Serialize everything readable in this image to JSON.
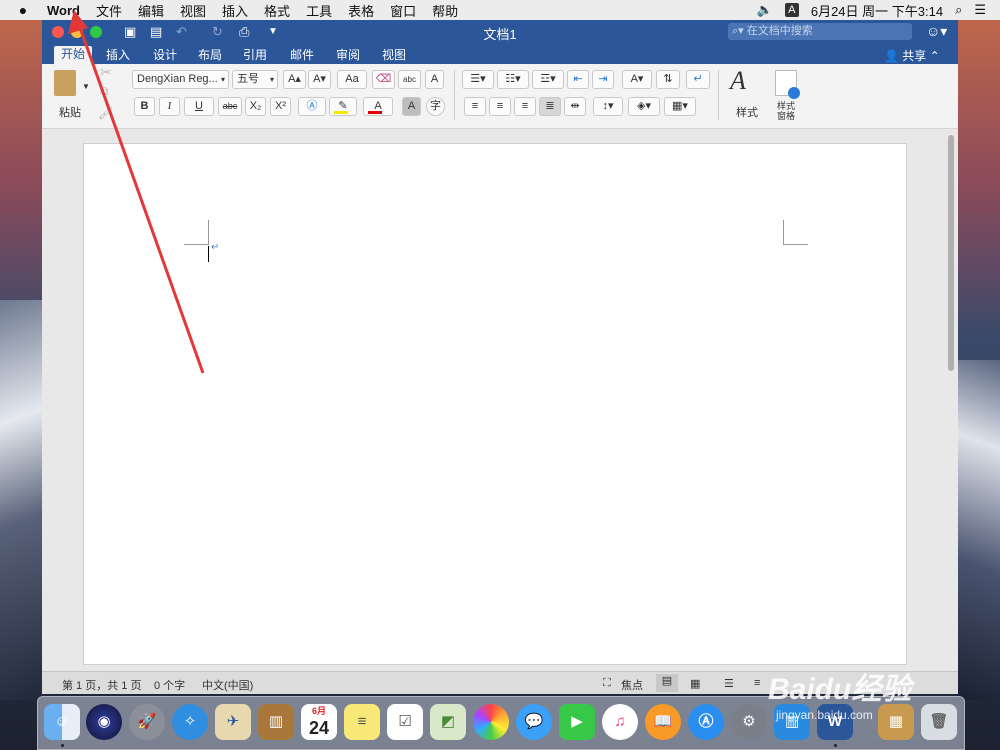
{
  "menubar": {
    "app_name": "Word",
    "menus": [
      "文件",
      "编辑",
      "视图",
      "插入",
      "格式",
      "工具",
      "表格",
      "窗口",
      "帮助"
    ],
    "input_method": "A",
    "clock": "6月24日 周一 下午3:14"
  },
  "window": {
    "title": "文档1",
    "search_placeholder": "在文档中搜索",
    "share_label": "共享",
    "tabs": [
      "开始",
      "插入",
      "设计",
      "布局",
      "引用",
      "邮件",
      "审阅",
      "视图"
    ],
    "active_tab": "开始"
  },
  "ribbon": {
    "paste_label": "粘贴",
    "font_name": "DengXian Reg...",
    "font_size": "五号",
    "bold": "B",
    "italic": "I",
    "underline": "U",
    "strikethrough": "abc",
    "subscript": "X₂",
    "superscript": "X²",
    "styles_label": "样式",
    "styles_pane_label": "样式\n窗格",
    "styles_pane_line1": "样式",
    "styles_pane_line2": "窗格",
    "grow_font": "A▴",
    "shrink_font": "A▾",
    "change_case": "Aa",
    "phonetic": "abc",
    "char_border": "A",
    "font_color": "A",
    "char_shading": "A",
    "enclose": "字",
    "highlight_color": "#f5e900",
    "font_color_value": "#e00000"
  },
  "statusbar": {
    "page": "第 1 页，共 1 页",
    "words": "0 个字",
    "language": "中文(中国)",
    "focus": "焦点"
  },
  "dock": {
    "calendar_month": "6月",
    "calendar_day": "24"
  },
  "watermark": {
    "brand": "Baidu经验",
    "url": "jingyan.baidu.com"
  }
}
